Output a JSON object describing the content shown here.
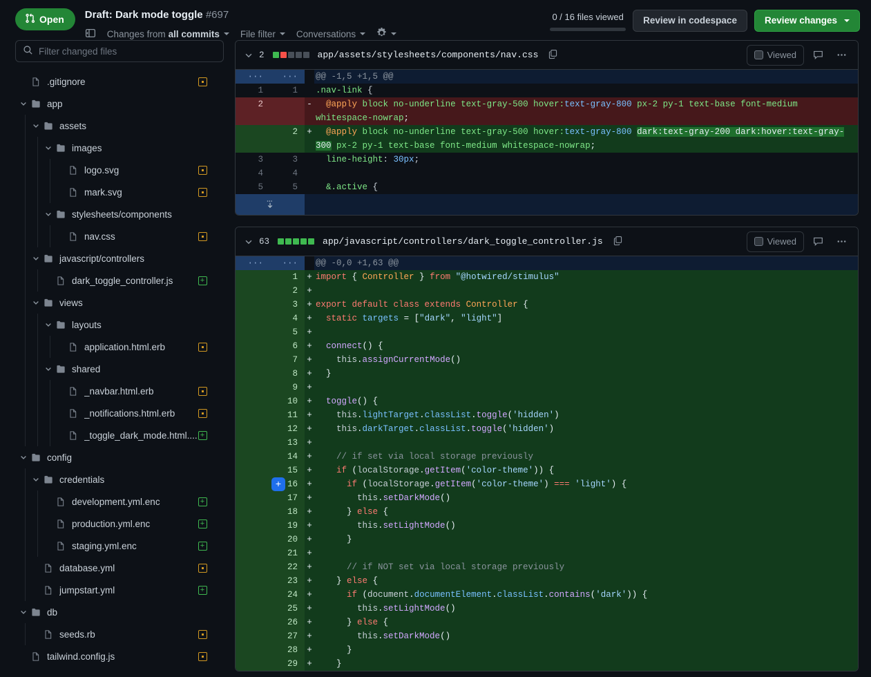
{
  "header": {
    "state_label": "Open",
    "state_icon": "git-pull-request-icon",
    "title": "Draft: Dark mode toggle",
    "number": "#697",
    "sidebar_toggle_icon": "sidebar-expand-icon",
    "tools": [
      {
        "prefix": "Changes from ",
        "strong": "all commits",
        "name": "changes-from-filter"
      },
      {
        "prefix": "File filter",
        "strong": "",
        "name": "file-filter"
      },
      {
        "prefix": "Conversations",
        "strong": "",
        "name": "conversations-filter"
      }
    ],
    "gear_icon": "gear-icon",
    "files_viewed": "0 / 16 files viewed",
    "review_codespace_label": "Review in codespace",
    "review_changes_label": "Review changes",
    "accent_green": "#238636",
    "progress_percent": 0
  },
  "sidebar": {
    "filter_placeholder": "Filter changed files",
    "filter_value": "",
    "search_icon": "search-icon",
    "items": [
      {
        "label": ".gitignore",
        "type": "file",
        "depth": 0,
        "status": "modified"
      },
      {
        "label": "app",
        "type": "folder",
        "depth": 0,
        "status": ""
      },
      {
        "label": "assets",
        "type": "folder",
        "depth": 1,
        "status": ""
      },
      {
        "label": "images",
        "type": "folder",
        "depth": 2,
        "status": ""
      },
      {
        "label": "logo.svg",
        "type": "file",
        "depth": 3,
        "status": "modified"
      },
      {
        "label": "mark.svg",
        "type": "file",
        "depth": 3,
        "status": "modified"
      },
      {
        "label": "stylesheets/components",
        "type": "folder",
        "depth": 2,
        "status": ""
      },
      {
        "label": "nav.css",
        "type": "file",
        "depth": 3,
        "status": "modified"
      },
      {
        "label": "javascript/controllers",
        "type": "folder",
        "depth": 1,
        "status": ""
      },
      {
        "label": "dark_toggle_controller.js",
        "type": "file",
        "depth": 2,
        "status": "added"
      },
      {
        "label": "views",
        "type": "folder",
        "depth": 1,
        "status": ""
      },
      {
        "label": "layouts",
        "type": "folder",
        "depth": 2,
        "status": ""
      },
      {
        "label": "application.html.erb",
        "type": "file",
        "depth": 3,
        "status": "modified"
      },
      {
        "label": "shared",
        "type": "folder",
        "depth": 2,
        "status": ""
      },
      {
        "label": "_navbar.html.erb",
        "type": "file",
        "depth": 3,
        "status": "modified"
      },
      {
        "label": "_notifications.html.erb",
        "type": "file",
        "depth": 3,
        "status": "modified"
      },
      {
        "label": "_toggle_dark_mode.html....",
        "type": "file",
        "depth": 3,
        "status": "added"
      },
      {
        "label": "config",
        "type": "folder",
        "depth": 0,
        "status": ""
      },
      {
        "label": "credentials",
        "type": "folder",
        "depth": 1,
        "status": ""
      },
      {
        "label": "development.yml.enc",
        "type": "file",
        "depth": 2,
        "status": "added"
      },
      {
        "label": "production.yml.enc",
        "type": "file",
        "depth": 2,
        "status": "added"
      },
      {
        "label": "staging.yml.enc",
        "type": "file",
        "depth": 2,
        "status": "added"
      },
      {
        "label": "database.yml",
        "type": "file",
        "depth": 1,
        "status": "modified"
      },
      {
        "label": "jumpstart.yml",
        "type": "file",
        "depth": 1,
        "status": "added"
      },
      {
        "label": "db",
        "type": "folder",
        "depth": 0,
        "status": ""
      },
      {
        "label": "seeds.rb",
        "type": "file",
        "depth": 1,
        "status": "modified"
      },
      {
        "label": "tailwind.config.js",
        "type": "file",
        "depth": 0,
        "status": "modified"
      }
    ]
  },
  "files": [
    {
      "name": "app/assets/stylesheets/components/nav.css",
      "change_count": "2",
      "stat_squares": [
        "green",
        "red",
        "gray",
        "gray",
        "gray"
      ],
      "copy_icon": "copy-path-icon",
      "viewed_label": "Viewed",
      "comment_icon": "comment-icon",
      "kebab_icon": "kebab-menu-icon",
      "hunk_header": "@@ -1,5 +1,5 @@",
      "expander_icon": "expand-down-icon"
    },
    {
      "name": "app/javascript/controllers/dark_toggle_controller.js",
      "change_count": "63",
      "stat_squares": [
        "green",
        "green",
        "green",
        "green",
        "green"
      ],
      "copy_icon": "copy-path-icon",
      "viewed_label": "Viewed",
      "comment_icon": "comment-icon",
      "kebab_icon": "kebab-menu-icon",
      "hunk_header": "@@ -0,0 +1,63 @@",
      "add_comment_line": 16,
      "add_comment_label": "+"
    }
  ]
}
